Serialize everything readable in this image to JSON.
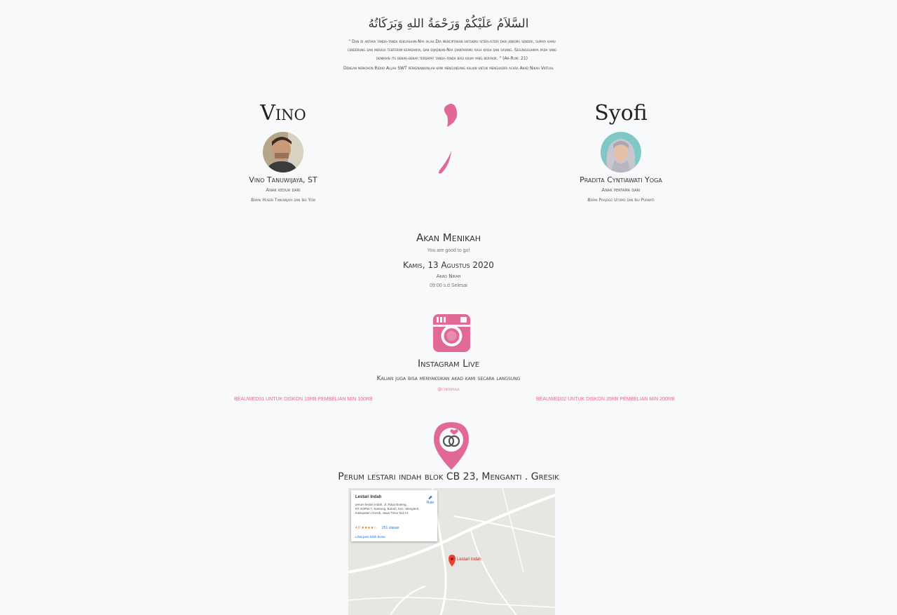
{
  "header": {
    "salam": "السَّلاَمُ عَلَيْكُمْ وَرَحْمَةُ اللهِ وَبَرَكَاتُهُ",
    "verse": "\" Dan di antara tanda-tanda kekuasaan-Nya ialah Dia menciptakan untukmu isteri-isteri dari jenismu sendiri, supaya kamu cenderung dan merasa tenteram kepadanya, dan dijadikan-Nya diantaramu rasa kasih dan sayang. Sesungguhnya pada yang demikian itu benar-benar terdapat tanda-tanda bagi kaum yang berfikir. \" (Ar-Rum: 21)",
    "invitation": "Dengan memohon Ridho Allah SWT perkenankanlah kami mengundang kalian untuk menghadiri acara Akad Nikah Virtual"
  },
  "groom": {
    "nickname": "Vino",
    "full_name": "Vino Tanuwijaya, ST",
    "child_order": "Anak kedua dari",
    "parents": "Bapak Husen Tanuwijaya dan Ibu Yeni"
  },
  "bride": {
    "nickname": "Syofi",
    "full_name": "Pradita Cyntiawati Yoga",
    "child_order": "Anak pertama dari",
    "parents": "Bapak Prajogo Utomo dan Ibu Purwati"
  },
  "event": {
    "title": "Akan Menikah",
    "subtitle": "You are good to go!",
    "date": "Kamis, 13 Agustus 2020",
    "name": "Akad Nikah",
    "time": "09:00 s.d Selesai"
  },
  "instagram": {
    "icon": "instagram-icon",
    "title": "Instagram Live",
    "subtitle": "Kalian juga bisa menyaksikan akad kami secara langsung",
    "handle": "@cyntiayoga",
    "promo_left": "BEAUWED01 UNTUK DISKON 15RB PEMBELIAN MIN 100RB",
    "promo_right": "BEAUWED02 UNTUK DISKON 35RB PEMBELIAN MIN 200RB"
  },
  "location": {
    "icon": "wedding-location-pin-icon",
    "address": "Perum lestari indah blok CB 23, Menganti . Gresik",
    "map": {
      "place_name": "Lestari Indah",
      "place_address": "perum lestari indah, Jl. Raya Boteng, RT.20/RW.7, Santong, Boboh, Kec. Menganti, Kabupaten Gresik, Jawa Timur 61174",
      "route_label": "Rute",
      "rating": "4,0 ★★★★☆",
      "reviews": "251 ulasan",
      "larger_map": "Lihat peta lebih besar",
      "marker_label": "Lestari Indah"
    }
  },
  "colors": {
    "accent": "#e06a95",
    "background": "#f8f9fa"
  }
}
